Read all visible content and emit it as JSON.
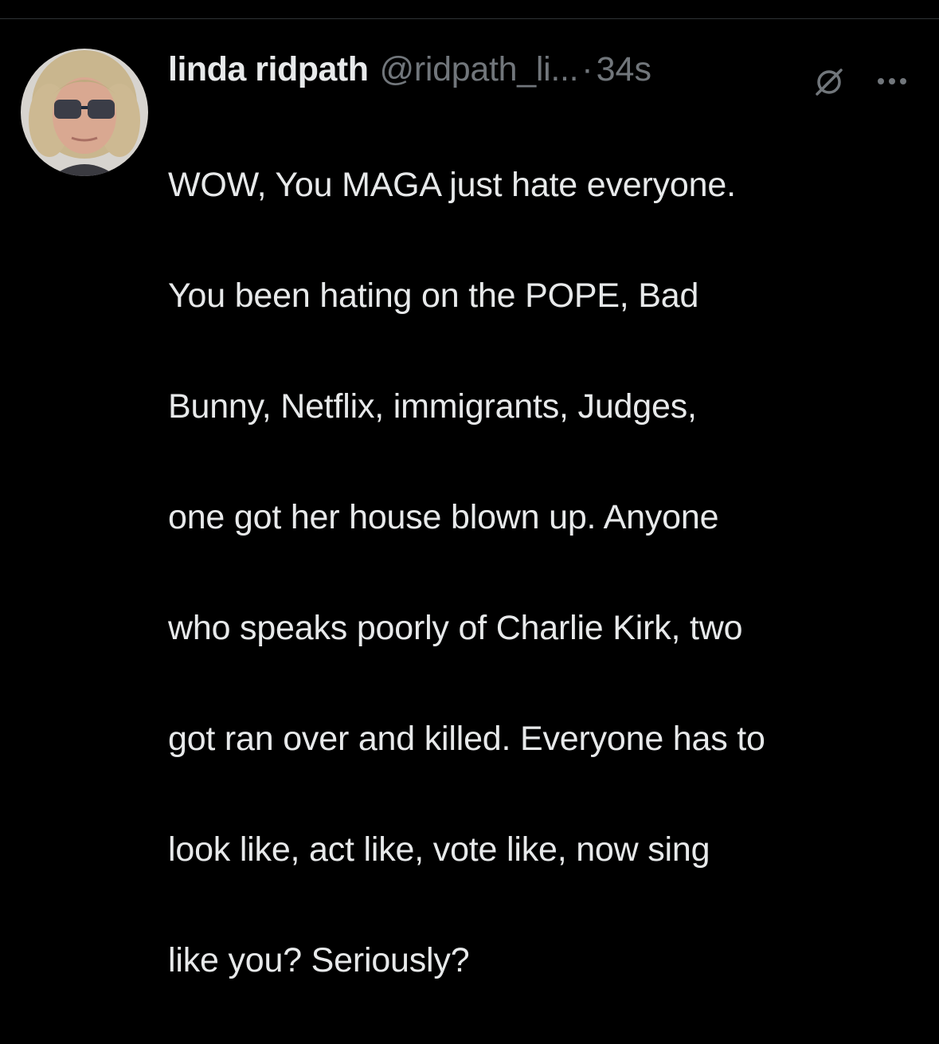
{
  "tweet": {
    "display_name": "linda ridpath",
    "handle": "@ridpath_li...",
    "separator": "·",
    "timestamp": "34s",
    "icons": {
      "grok": "grok-slash-circle-icon",
      "more": "more-horizontal-icon"
    },
    "text_lines": [
      "WOW, You MAGA just hate everyone.",
      "You been hating on the POPE, Bad",
      "Bunny, Netflix, immigrants, Judges,",
      "one got her house blown up. Anyone",
      "who speaks poorly of Charlie Kirk, two",
      "got ran over and killed. Everyone has to",
      "look like, act like, vote like, now sing",
      "like you? Seriously?"
    ]
  },
  "colors": {
    "background": "#000000",
    "primary_text": "#e7e9ea",
    "secondary_text": "#71767b",
    "divider": "#2f3336"
  }
}
